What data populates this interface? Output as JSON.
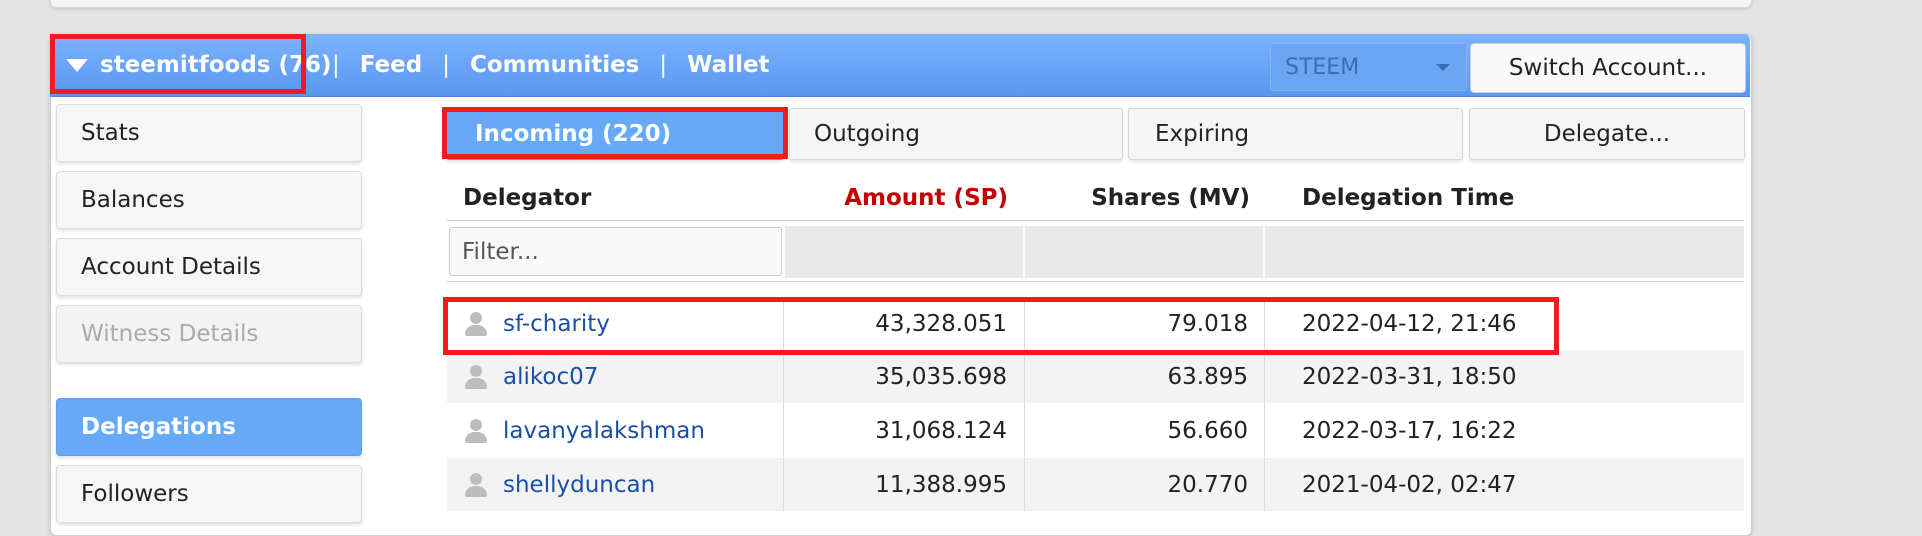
{
  "nav": {
    "account": "steemitfoods (76)",
    "separator": "|",
    "links": [
      "Feed",
      "Communities",
      "Wallet"
    ],
    "currency_select": "STEEM",
    "switch_account": "Switch Account..."
  },
  "sidebar": {
    "items": [
      {
        "label": "Stats",
        "state": "normal"
      },
      {
        "label": "Balances",
        "state": "normal"
      },
      {
        "label": "Account Details",
        "state": "normal"
      },
      {
        "label": "Witness Details",
        "state": "disabled"
      },
      {
        "label": "Delegations",
        "state": "active"
      },
      {
        "label": "Followers",
        "state": "normal"
      }
    ]
  },
  "tabs": [
    {
      "label": "Incoming (220)",
      "active": true
    },
    {
      "label": "Outgoing",
      "active": false
    },
    {
      "label": "Expiring",
      "active": false
    },
    {
      "label": "Delegate...",
      "active": false
    }
  ],
  "table": {
    "columns": [
      "Delegator",
      "Amount (SP)",
      "Shares (MV)",
      "Delegation Time"
    ],
    "filter_placeholder": "Filter...",
    "rows": [
      {
        "delegator": "sf-charity",
        "amount": "43,328.051",
        "shares": "79.018",
        "time": "2022-04-12, 21:46"
      },
      {
        "delegator": "alikoc07",
        "amount": "35,035.698",
        "shares": "63.895",
        "time": "2022-03-31, 18:50"
      },
      {
        "delegator": "lavanyalakshman",
        "amount": "31,068.124",
        "shares": "56.660",
        "time": "2022-03-17, 16:22"
      },
      {
        "delegator": "shellyduncan",
        "amount": "11,388.995",
        "shares": "20.770",
        "time": "2021-04-02, 02:47"
      }
    ]
  },
  "colors": {
    "nav_blue": "#5a97f0",
    "active_blue": "#66aaf7",
    "link_blue": "#1a4fa8",
    "amount_header_red": "#c30000",
    "highlight_red": "#ee1c1c"
  }
}
